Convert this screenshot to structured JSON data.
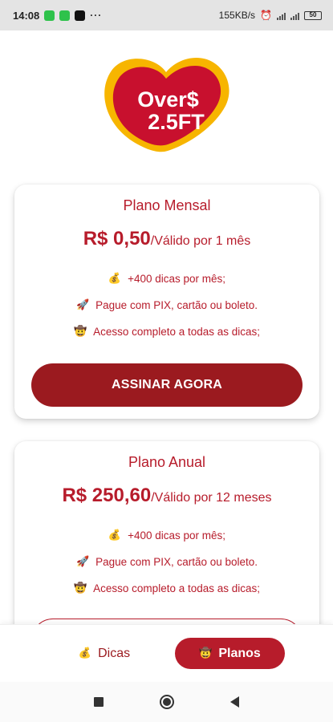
{
  "status_bar": {
    "time": "14:08",
    "more": "···",
    "network_speed": "155KB/s",
    "battery": "50"
  },
  "logo": {
    "line1": "Over$",
    "line2": "2.5FT",
    "colors": {
      "outer": "#f7b500",
      "inner": "#c8102e"
    }
  },
  "plans": [
    {
      "title": "Plano Mensal",
      "price": "R$ 0,50",
      "period": "/Válido por 1 mês",
      "features": [
        {
          "icon": "money-bag-icon",
          "glyph": "💰",
          "text": "+400 dicas por mês;"
        },
        {
          "icon": "rocket-icon",
          "glyph": "🚀",
          "text": "Pague com PIX, cartão ou boleto."
        },
        {
          "icon": "cowboy-face-icon",
          "glyph": "🤠",
          "text": "Acesso completo a todas as dicas;"
        }
      ],
      "button_label": "ASSINAR AGORA"
    },
    {
      "title": "Plano Anual",
      "price": "R$ 250,60",
      "period": "/Válido por 12 meses",
      "features": [
        {
          "icon": "money-bag-icon",
          "glyph": "💰",
          "text": "+400 dicas por mês;"
        },
        {
          "icon": "rocket-icon",
          "glyph": "🚀",
          "text": "Pague com PIX, cartão ou boleto."
        },
        {
          "icon": "cowboy-face-icon",
          "glyph": "🤠",
          "text": "Acesso completo a todas as dicas;"
        }
      ],
      "button_label": ""
    }
  ],
  "bottom_nav": {
    "tabs": [
      {
        "label": "Dicas",
        "icon": "money-bag-icon",
        "glyph": "💰",
        "active": false
      },
      {
        "label": "Planos",
        "icon": "cowboy-face-icon",
        "glyph": "🤠",
        "active": true
      }
    ]
  },
  "colors": {
    "brand": "#b71c2b",
    "button": "#9b1a1f",
    "status_bar_bg": "#e4e4e4"
  }
}
